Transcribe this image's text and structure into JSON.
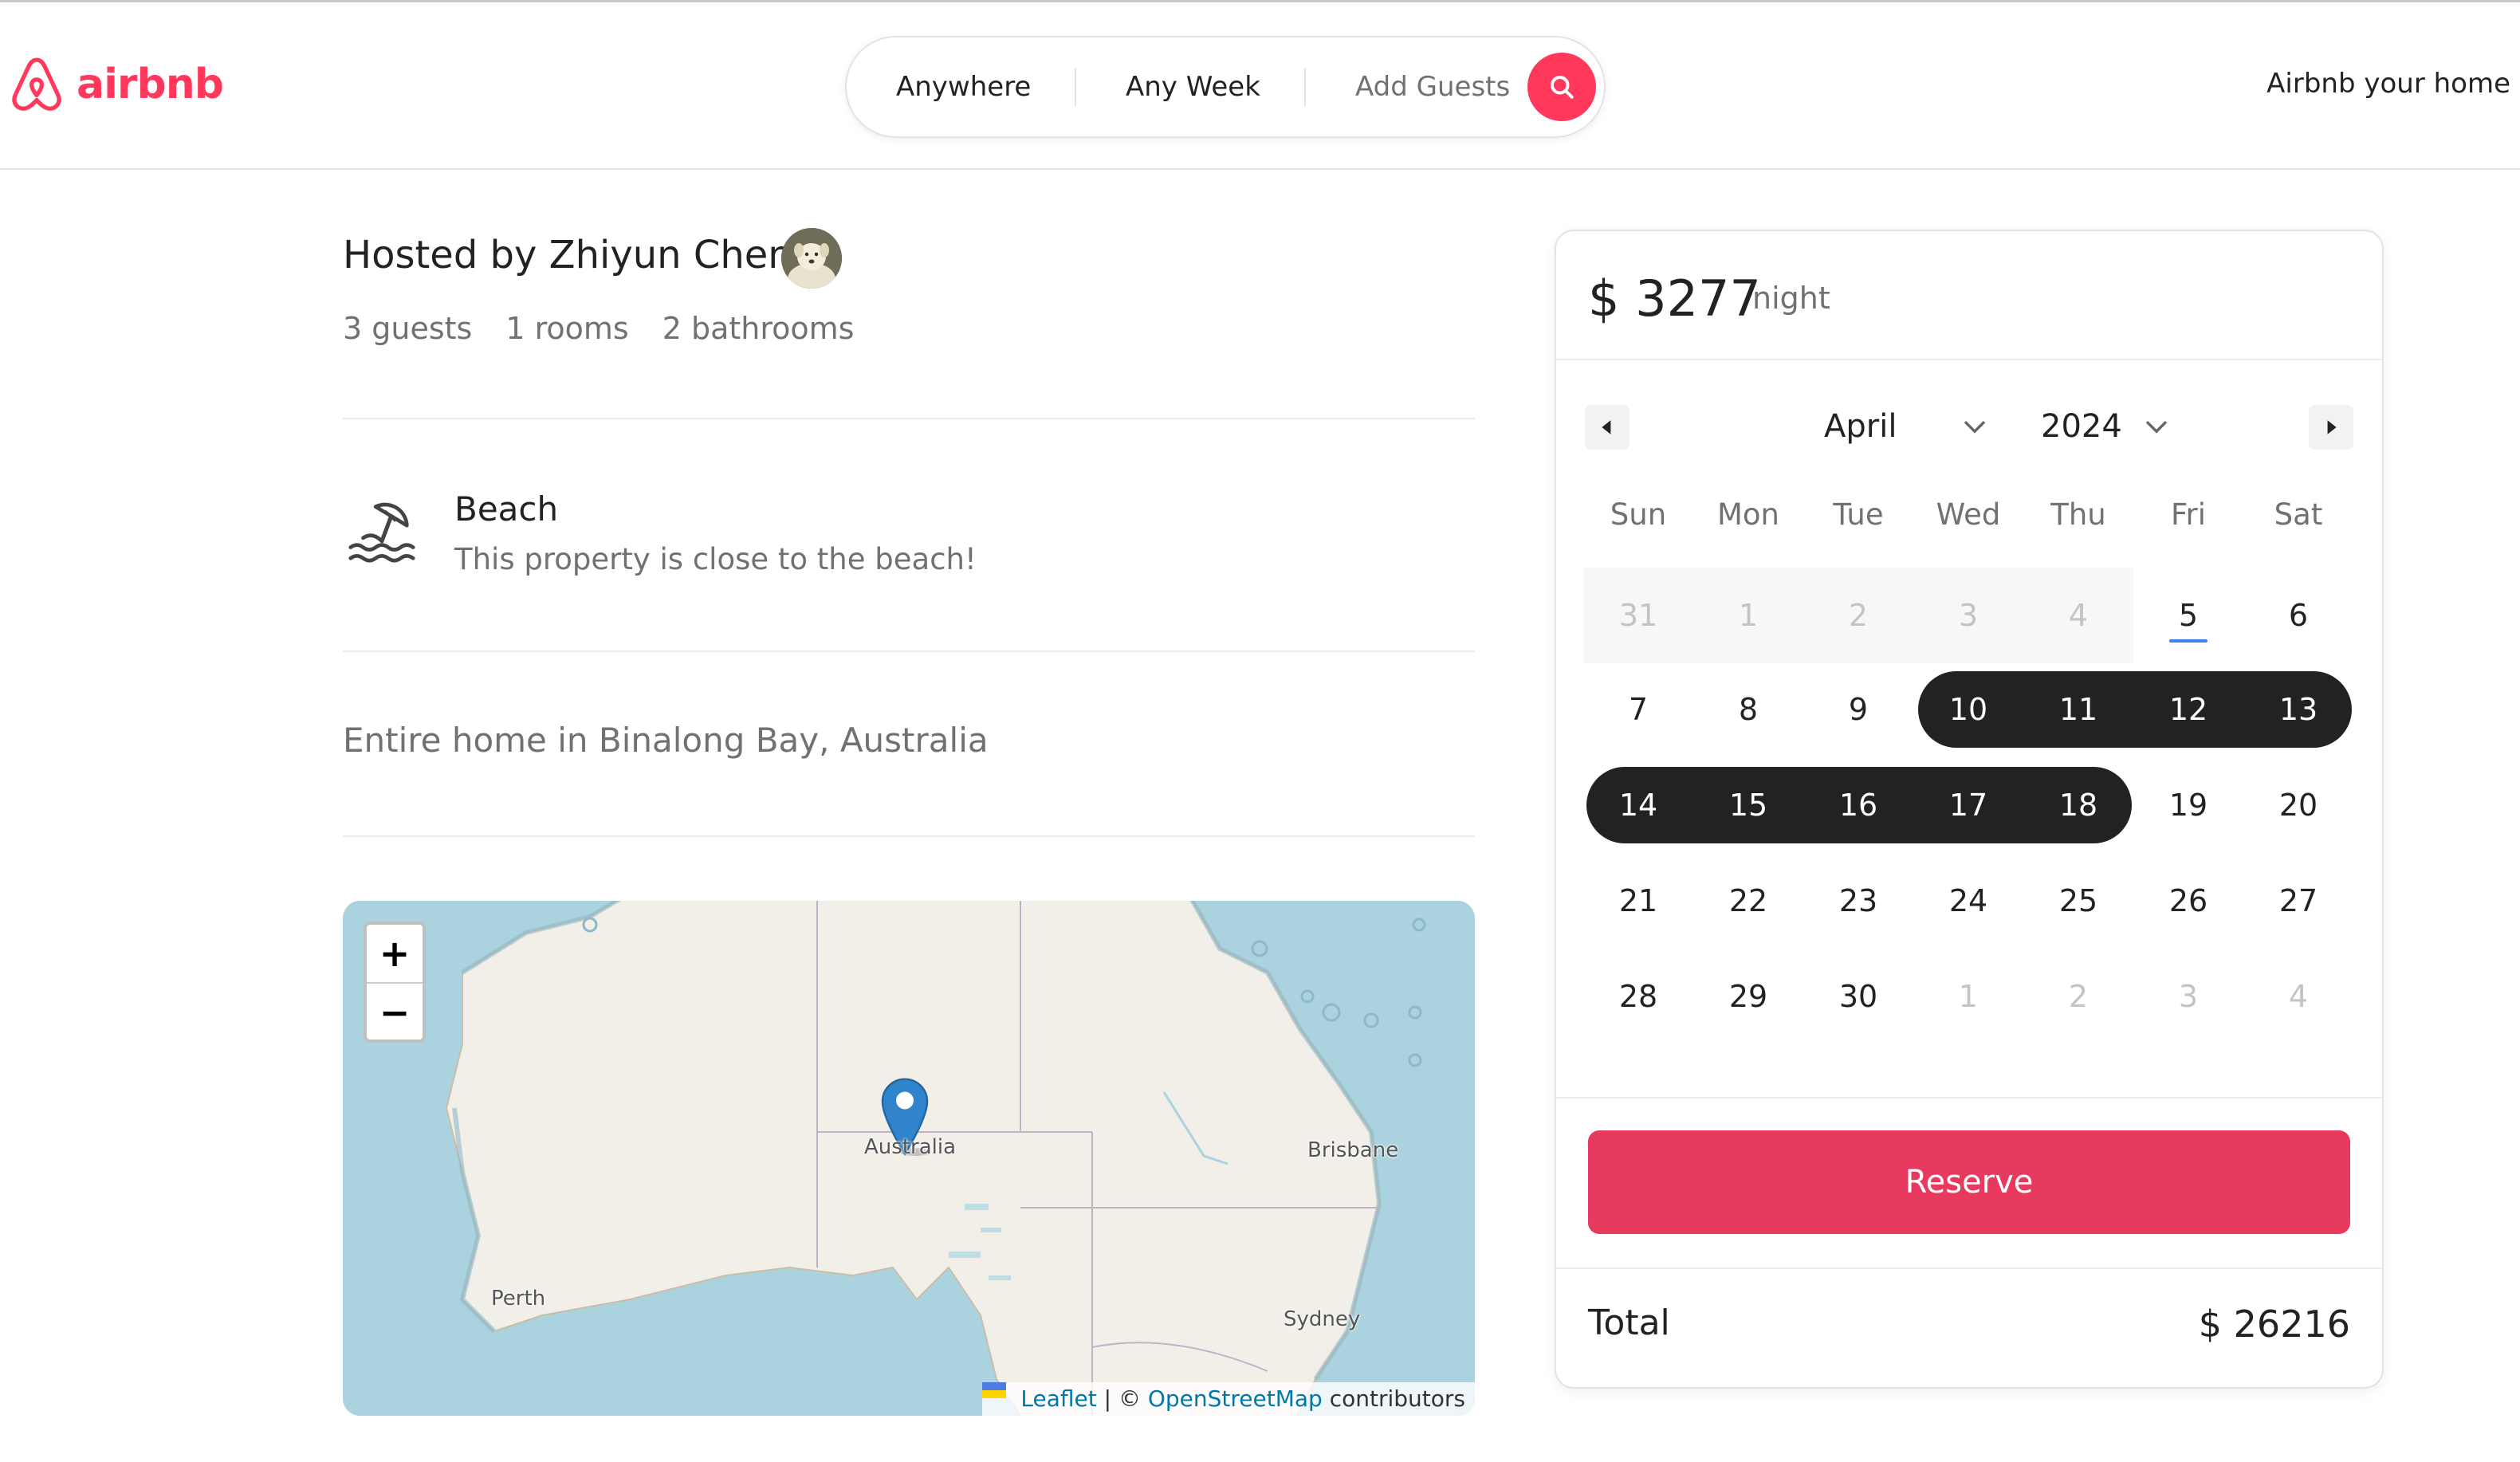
{
  "header": {
    "logo_text": "airbnb",
    "search": {
      "location": "Anywhere",
      "week": "Any Week",
      "guests": "Add Guests"
    },
    "host_link": "Airbnb your home"
  },
  "listing": {
    "host_title": "Hosted by Zhiyun Chen",
    "stats": [
      "3 guests",
      "1 rooms",
      "2 bathrooms"
    ],
    "feature": {
      "title": "Beach",
      "description": "This property is close to the beach!"
    },
    "location": "Entire home in Binalong Bay, Australia"
  },
  "map": {
    "zoom_in": "+",
    "zoom_out": "−",
    "labels": {
      "australia": "Australia",
      "brisbane": "Brisbane",
      "perth": "Perth",
      "sydney": "Sydney"
    },
    "attribution": {
      "leaflet": "Leaflet",
      "separator": " | © ",
      "osm": "OpenStreetMap",
      "contributors": " contributors"
    }
  },
  "booking": {
    "price": "$ 3277",
    "price_unit": "night",
    "month": "April",
    "year": "2024",
    "weekdays": [
      "Sun",
      "Mon",
      "Tue",
      "Wed",
      "Thu",
      "Fri",
      "Sat"
    ],
    "weeks": [
      [
        "31",
        "1",
        "2",
        "3",
        "4",
        "5",
        "6"
      ],
      [
        "7",
        "8",
        "9",
        "10",
        "11",
        "12",
        "13"
      ],
      [
        "14",
        "15",
        "16",
        "17",
        "18",
        "19",
        "20"
      ],
      [
        "21",
        "22",
        "23",
        "24",
        "25",
        "26",
        "27"
      ],
      [
        "28",
        "29",
        "30",
        "1",
        "2",
        "3",
        "4"
      ]
    ],
    "reserve_label": "Reserve",
    "total_label": "Total",
    "total_value": "$ 26216"
  },
  "colors": {
    "brand": "#ff385c",
    "reserve": "#e8395f",
    "selected": "#222222",
    "today_underline": "#3b82f6"
  }
}
